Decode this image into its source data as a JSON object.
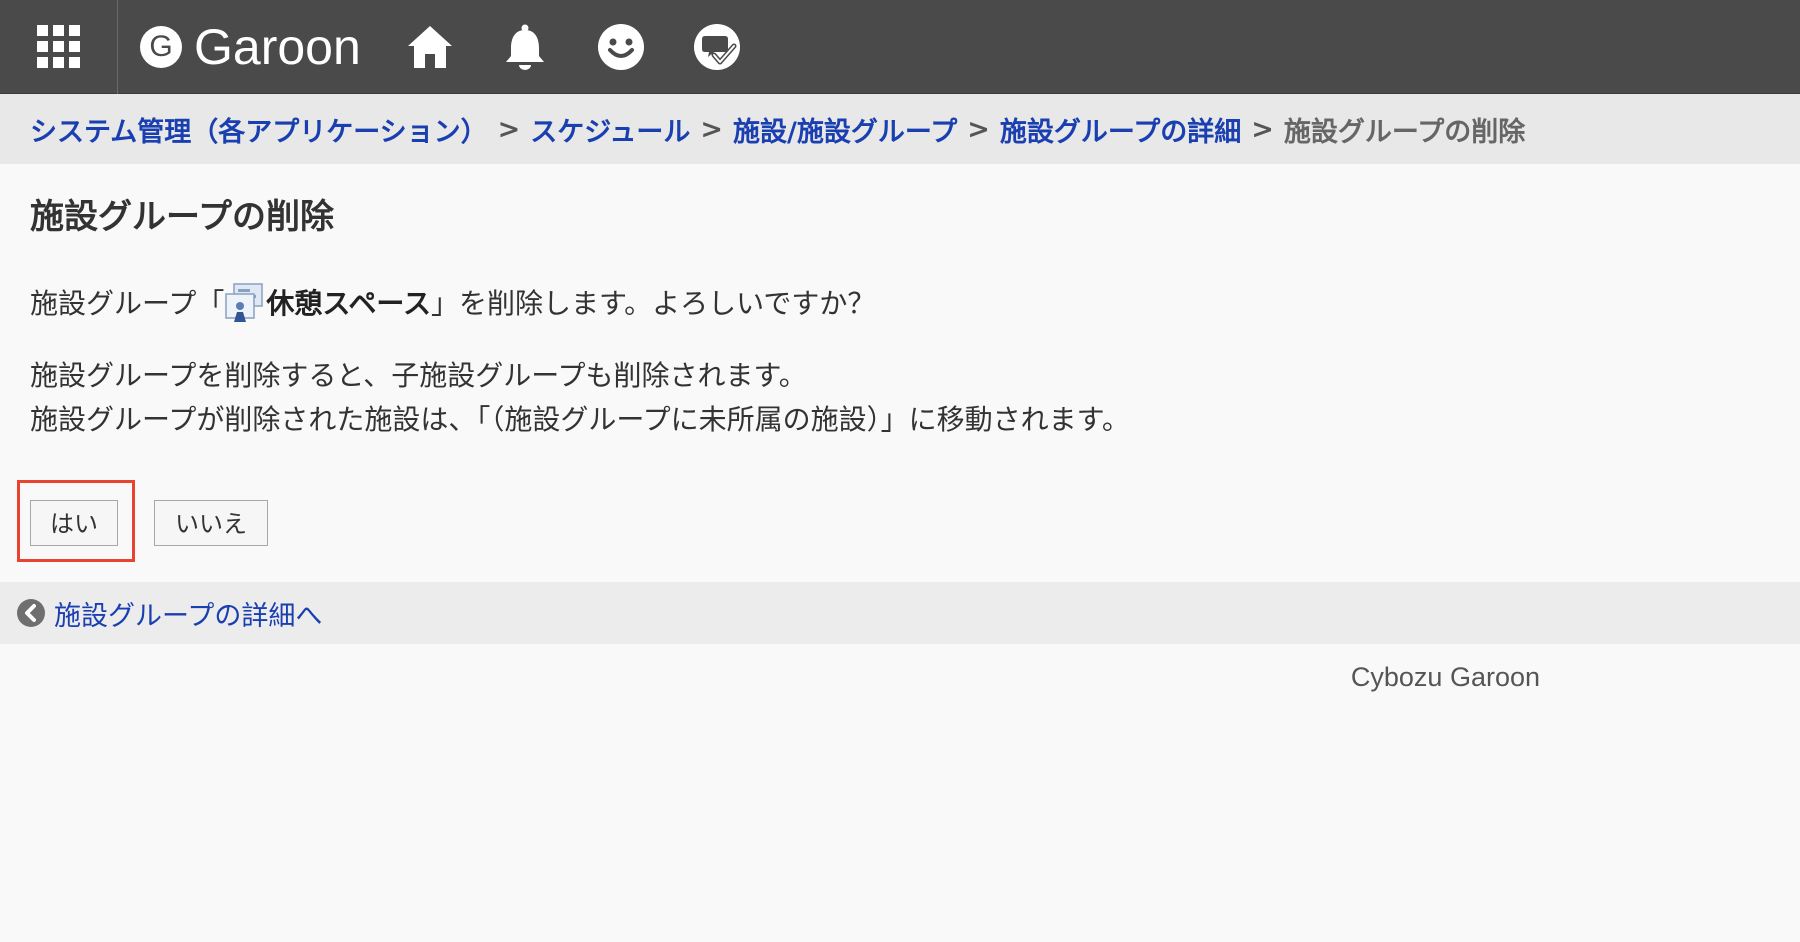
{
  "header": {
    "apps_icon": "grid-icon",
    "brand_logo_letter": "G",
    "brand_name": "Garoon",
    "nav_icons": [
      "home-icon",
      "bell-icon",
      "smiley-icon",
      "chat-check-icon"
    ]
  },
  "breadcrumb": {
    "items": [
      "システム管理（各アプリケーション）",
      "スケジュール",
      "施設/施設グループ",
      "施設グループの詳細"
    ],
    "separator": ">",
    "current": "施設グループの削除"
  },
  "main": {
    "title": "施設グループの削除",
    "confirm_prefix": "施設グループ「",
    "facility_icon": "facility-group-icon",
    "facility_name": "休憩スペース",
    "confirm_suffix": "」を削除します。よろしいですか？",
    "info_line_1": "施設グループを削除すると、子施設グループも削除されます。",
    "info_line_2": "施設グループが削除された施設は、「（施設グループに未所属の施設）」に移動されます。",
    "yes_label": "はい",
    "no_label": "いいえ"
  },
  "back_bar": {
    "icon": "back-arrow-icon",
    "label": "施設グループの詳細へ"
  },
  "footer": {
    "text": "Cybozu Garoon"
  },
  "colors": {
    "header_bg": "#4a4a4a",
    "link": "#1a3fb0",
    "highlight": "#e8432f",
    "breadcrumb_bg": "#e8e8e8"
  }
}
